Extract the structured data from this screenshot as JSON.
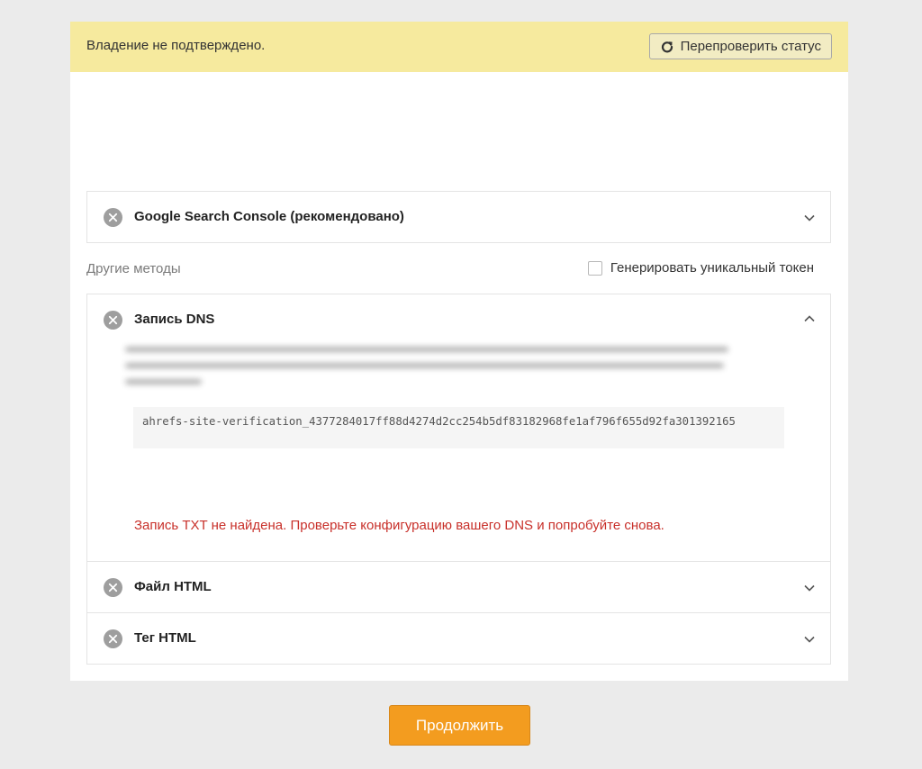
{
  "banner": {
    "status_text": "Владение не подтверждено.",
    "recheck_label": "Перепроверить статус"
  },
  "gsc": {
    "title": "Google Search Console (рекомендовано)"
  },
  "other_methods": {
    "label": "Другие методы",
    "token_checkbox_label": "Генерировать уникальный токен",
    "token_checked": false
  },
  "methods": [
    {
      "title": "Запись DNS",
      "expanded": true,
      "code": "ahrefs-site-verification_4377284017ff88d4274d2cc254b5df83182968fe1af796f655d92fa301392165",
      "error": "Запись TXT не найдена. Проверьте конфигурацию вашего DNS и попробуйте снова."
    },
    {
      "title": "Файл HTML",
      "expanded": false
    },
    {
      "title": "Тег HTML",
      "expanded": false
    }
  ],
  "footer": {
    "continue_label": "Продолжить"
  },
  "colors": {
    "banner_bg": "#f6ea9e",
    "accent_button": "#f39c1f",
    "error": "#c8302a"
  },
  "icons": [
    "refresh-icon",
    "close-circle-icon",
    "chevron-down-icon",
    "chevron-up-icon"
  ]
}
